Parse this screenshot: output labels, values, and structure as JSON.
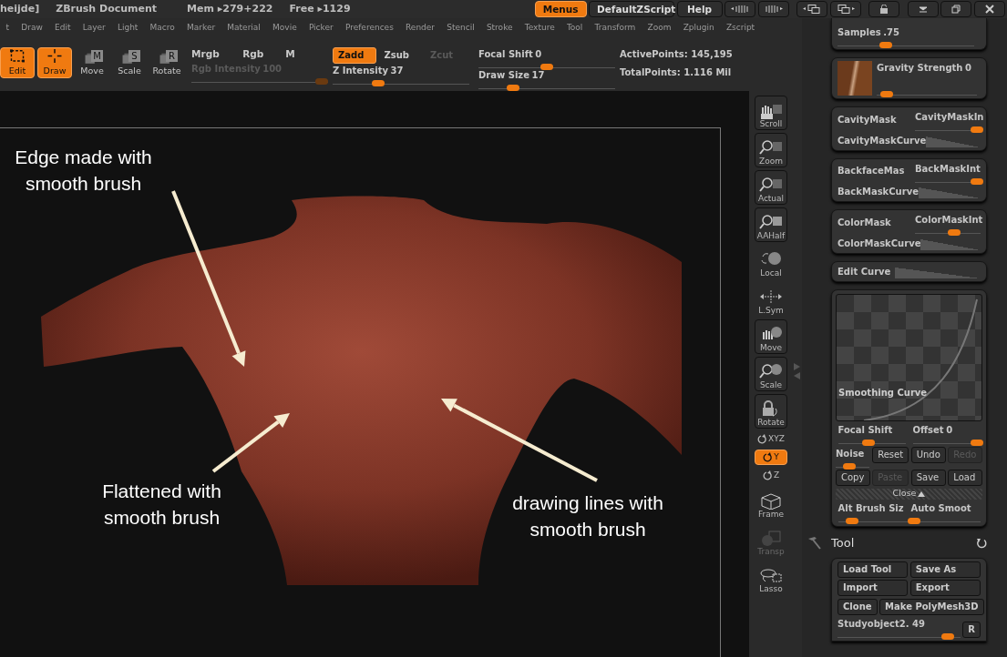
{
  "title_bar": {
    "document": "heijde]",
    "app": "ZBrush Document",
    "mem": "Mem ▸279+222",
    "free": "Free ▸1129"
  },
  "top_buttons": [
    {
      "label": "Menus",
      "selected": true
    },
    {
      "label": "DefaultZScript",
      "selected": false
    },
    {
      "label": "Help",
      "selected": false
    }
  ],
  "menu": [
    "t",
    "Draw",
    "Edit",
    "Layer",
    "Light",
    "Macro",
    "Marker",
    "Material",
    "Movie",
    "Picker",
    "Preferences",
    "Render",
    "Stencil",
    "Stroke",
    "Texture",
    "Tool",
    "Transform",
    "Zoom",
    "Zplugin",
    "Zscript"
  ],
  "toolbar": {
    "modes": [
      {
        "kind": "edit",
        "label": "Edit",
        "selected": true
      },
      {
        "kind": "draw",
        "label": "Draw",
        "selected": true
      },
      {
        "kind": "move",
        "label": "Move",
        "key": "M",
        "selected": false
      },
      {
        "kind": "scale",
        "label": "Scale",
        "key": "S",
        "selected": false
      },
      {
        "kind": "rotate",
        "label": "Rotate",
        "key": "R",
        "selected": false
      }
    ],
    "color_modes": [
      "Mrgb",
      "Rgb",
      "M"
    ],
    "rgb_intensity": {
      "label": "Rgb Intensity",
      "value": "100",
      "level": 0.95,
      "disabled": true
    },
    "z_modes": [
      {
        "label": "Zadd",
        "selected": true,
        "disabled": false
      },
      {
        "label": "Zsub",
        "selected": false,
        "disabled": false
      },
      {
        "label": "Zcut",
        "selected": false,
        "disabled": true
      }
    ],
    "z_intensity": {
      "label": "Z Intensity",
      "value": "37",
      "level": 0.33
    },
    "focal_shift": {
      "label": "Focal Shift",
      "value": "0",
      "level": 0.5
    },
    "draw_size": {
      "label": "Draw Size",
      "value": "17",
      "level": 0.25
    },
    "stats": [
      "ActivePoints: 145,195",
      "TotalPoints: 1.116 Mil"
    ]
  },
  "annotations": [
    "Edge made with\nsmooth brush",
    "Flattened with\nsmooth brush",
    "drawing lines with\nsmooth brush"
  ],
  "shelf": [
    {
      "kind": "scroll",
      "label": "Scroll",
      "selected": false,
      "disabled": false
    },
    {
      "kind": "zoom",
      "label": "Zoom",
      "selected": false,
      "disabled": false
    },
    {
      "kind": "actual",
      "label": "Actual",
      "selected": false,
      "disabled": false
    },
    {
      "kind": "aahalf",
      "label": "AAHalf",
      "selected": false,
      "disabled": false
    },
    {
      "kind": "local",
      "label": "Local",
      "selected": false,
      "disabled": false
    },
    {
      "kind": "lsym",
      "label": "L.Sym",
      "selected": false,
      "disabled": false
    },
    {
      "kind": "move",
      "label": "Move",
      "selected": false,
      "disabled": false
    },
    {
      "kind": "scale",
      "label": "Scale",
      "selected": false,
      "disabled": false
    },
    {
      "kind": "rotate",
      "label": "Rotate",
      "selected": false,
      "disabled": false
    },
    {
      "kind": "axis",
      "label": "XYZ",
      "selected": false,
      "disabled": false
    },
    {
      "kind": "axis",
      "label": "Y",
      "selected": true,
      "disabled": false
    },
    {
      "kind": "axis",
      "label": "Z",
      "selected": false,
      "disabled": false
    },
    {
      "kind": "frame",
      "label": "Frame",
      "selected": false,
      "disabled": false
    },
    {
      "kind": "transp",
      "label": "Transp",
      "selected": false,
      "disabled": true
    },
    {
      "kind": "lasso",
      "label": "Lasso",
      "selected": false,
      "disabled": false
    }
  ],
  "brush_panel": {
    "samples": {
      "label": "Samples",
      "value": ".75",
      "level": 0.35
    },
    "gravity": {
      "label": "Gravity Strength",
      "value": "0",
      "level": 0.05
    },
    "masks": [
      {
        "label": "CavityMask",
        "slider": "CavityMaskIn",
        "level": 0.95,
        "curve": "CavityMaskCurve"
      },
      {
        "label": "BackfaceMas",
        "slider": "BackMaskInt",
        "level": 0.95,
        "curve": "BackMaskCurve"
      },
      {
        "label": "ColorMask",
        "slider": "ColorMaskInt",
        "level": 0.6,
        "curve": "ColorMaskCurve"
      }
    ],
    "edit_curve": "Edit Curve",
    "curve": {
      "title": "Smoothing Curve",
      "sliders": [
        {
          "label": "Focal Shift",
          "level": 0.45
        },
        {
          "label": "Offset",
          "value": "0",
          "level": 0.95
        }
      ],
      "noise": {
        "label": "Noise",
        "level": 0.4
      },
      "buttons": [
        {
          "label": "Reset",
          "disabled": false
        },
        {
          "label": "Undo",
          "disabled": false
        },
        {
          "label": "Redo",
          "disabled": true
        },
        {
          "label": "Copy",
          "disabled": false
        },
        {
          "label": "Paste",
          "disabled": true
        },
        {
          "label": "Save",
          "disabled": false
        },
        {
          "label": "Load",
          "disabled": false
        }
      ],
      "close": "Close",
      "bottom_sliders": [
        {
          "label": "Alt Brush Siz",
          "level": 0.2
        },
        {
          "label": "Auto Smoot",
          "level": 0.05
        }
      ]
    }
  },
  "tool": {
    "title": "Tool",
    "buttons": [
      [
        "Load Tool",
        "Save As"
      ],
      [
        "Import",
        "Export"
      ],
      [
        "Clone",
        "Make PolyMesh3D"
      ]
    ],
    "subtool": {
      "label": "Studyobject2. 49",
      "level": 0.9
    },
    "r_button": "R"
  }
}
